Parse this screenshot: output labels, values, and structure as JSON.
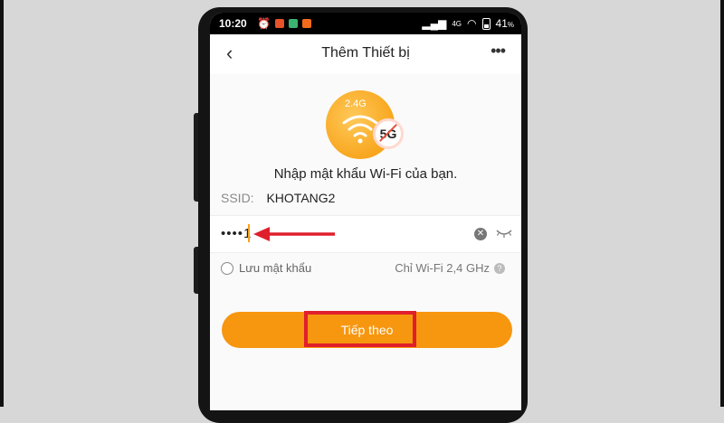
{
  "status_bar": {
    "time": "10:20",
    "signal_text": "4G",
    "battery": "41",
    "battery_unit": "%",
    "icons": [
      "alarm-icon",
      "video-icon",
      "drive-icon",
      "shopee-icon",
      "sim-signal-icon",
      "wifi-icon",
      "battery-icon"
    ]
  },
  "header": {
    "title": "Thêm Thiết bị",
    "back_icon": "‹",
    "more_icon": "•••"
  },
  "wifi_graphic": {
    "band_supported": "2.4G",
    "band_unsupported": "5G"
  },
  "prompt_text": "Nhập mật khẩu Wi-Fi của bạn.",
  "ssid": {
    "label": "SSID:",
    "value": "KHOTANG2"
  },
  "password": {
    "value": "••••1"
  },
  "save_password_label": "Lưu mật khẩu",
  "wifi_note": "Chỉ Wi-Fi 2,4 GHz",
  "help_icon": "?",
  "next_button_label": "Tiếp theo",
  "colors": {
    "accent": "#f7960f",
    "annotation_red": "#e01f2c"
  }
}
